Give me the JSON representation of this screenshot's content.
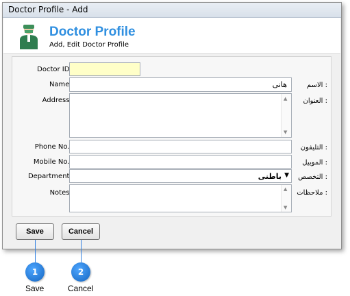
{
  "window": {
    "title": "Doctor Profile - Add"
  },
  "header": {
    "title": "Doctor Profile",
    "subtitle": "Add, Edit Doctor Profile"
  },
  "form": {
    "doctor_id": {
      "label": "Doctor ID :",
      "value": ""
    },
    "name": {
      "label": "Name :",
      "arabic_label": "الاسم :",
      "value": "هانى"
    },
    "address": {
      "label": "Address :",
      "arabic_label": "العنوان :",
      "value": ""
    },
    "phone": {
      "label": "Phone No. :",
      "arabic_label": "التليفون :",
      "value": ""
    },
    "mobile": {
      "label": "Mobile No. :",
      "arabic_label": "الموبيل :",
      "value": ""
    },
    "department": {
      "label": "Department :",
      "arabic_label": "التخصص :",
      "value": "باطنى"
    },
    "notes": {
      "label": "Notes :",
      "arabic_label": "ملاحظات :",
      "value": ""
    }
  },
  "buttons": {
    "save": "Save",
    "cancel": "Cancel"
  },
  "callouts": [
    {
      "number": "1",
      "caption": "Save"
    },
    {
      "number": "2",
      "caption": "Cancel"
    }
  ],
  "colors": {
    "accent": "#2f8fe0",
    "badge": "#1e7be0",
    "id_field": "#ffffc8"
  }
}
